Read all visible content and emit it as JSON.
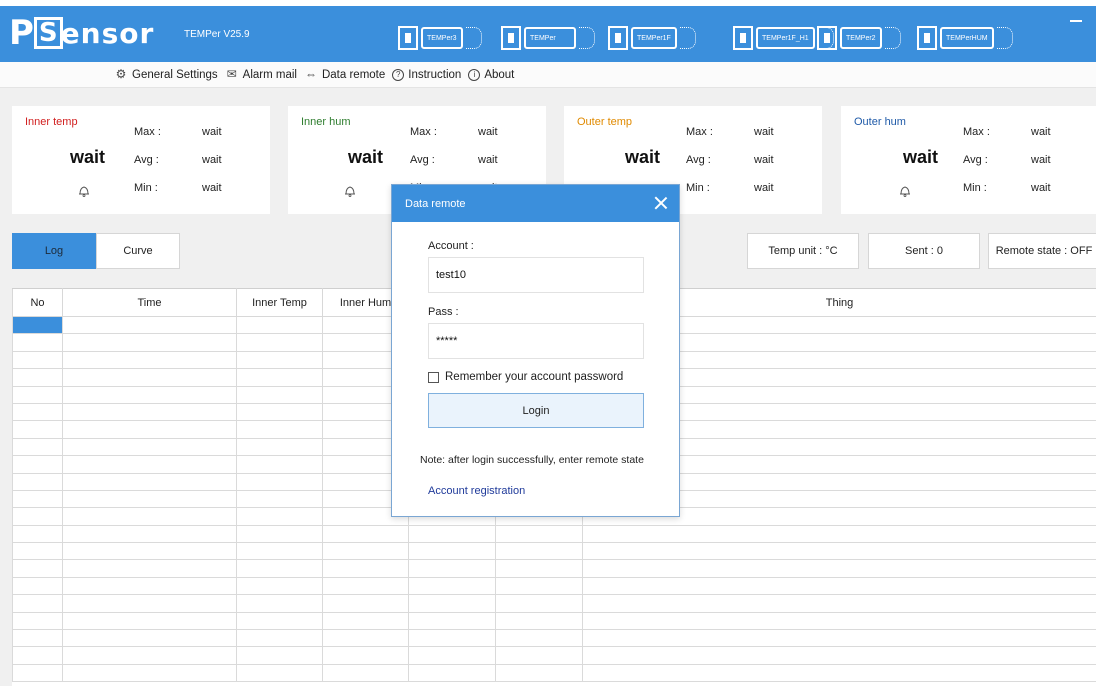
{
  "app": {
    "logo": {
      "p": "P",
      "s": "S",
      "rest": "ensor"
    },
    "version": "TEMPer V25.9"
  },
  "devices": [
    "TEMPer3",
    "TEMPer",
    "TEMPer1F",
    "TEMPer1F_H1",
    "TEMPer2",
    "TEMPerHUM"
  ],
  "menu": [
    {
      "label": "General Settings",
      "icon": "gear-icon",
      "glyph": "⚙"
    },
    {
      "label": "Alarm mail",
      "icon": "mail-icon",
      "glyph": "✉"
    },
    {
      "label": "Data remote",
      "icon": "remote-icon",
      "glyph": "⇔"
    },
    {
      "label": "Instruction",
      "icon": "help-icon",
      "glyph": "?"
    },
    {
      "label": "About",
      "icon": "info-icon",
      "glyph": "i"
    }
  ],
  "cards": [
    {
      "label": "Inner temp",
      "color": "#d11f1f",
      "value": "wait",
      "max_label": "Max :",
      "max": "wait",
      "avg_label": "Avg :",
      "avg": "wait",
      "min_label": "Min :",
      "min": "wait"
    },
    {
      "label": "Inner hum",
      "color": "#2e7d2e",
      "value": "wait",
      "max_label": "Max :",
      "max": "wait",
      "avg_label": "Avg :",
      "avg": "wait",
      "min_label": "Min :",
      "min": "wait"
    },
    {
      "label": "Outer temp",
      "color": "#e08a00",
      "value": "wait",
      "max_label": "Max :",
      "max": "wait",
      "avg_label": "Avg :",
      "avg": "wait",
      "min_label": "Min :",
      "min": "wait"
    },
    {
      "label": "Outer hum",
      "color": "#1f5aa8",
      "value": "wait",
      "max_label": "Max :",
      "max": "wait",
      "avg_label": "Avg :",
      "avg": "wait",
      "min_label": "Min :",
      "min": "wait"
    }
  ],
  "tabs": [
    {
      "label": "Log",
      "active": true
    },
    {
      "label": "Curve",
      "active": false
    }
  ],
  "status": {
    "temp_unit": "Temp unit : °C",
    "sent": "Sent :  0",
    "remote_state": "Remote state : OFF"
  },
  "table": {
    "headers": [
      "No",
      "Time",
      "Inner Temp",
      "Inner Hum",
      "",
      "",
      "Thing"
    ]
  },
  "dialog": {
    "title": "Data remote",
    "account_label": "Account :",
    "account_value": "test10",
    "pass_label": "Pass :",
    "pass_value": "*****",
    "remember_label": "Remember your account password",
    "login_label": "Login",
    "note": "Note: after login successfully, enter remote state",
    "register_label": "Account registration"
  },
  "colors": {
    "accent": "#3b8fdc"
  }
}
